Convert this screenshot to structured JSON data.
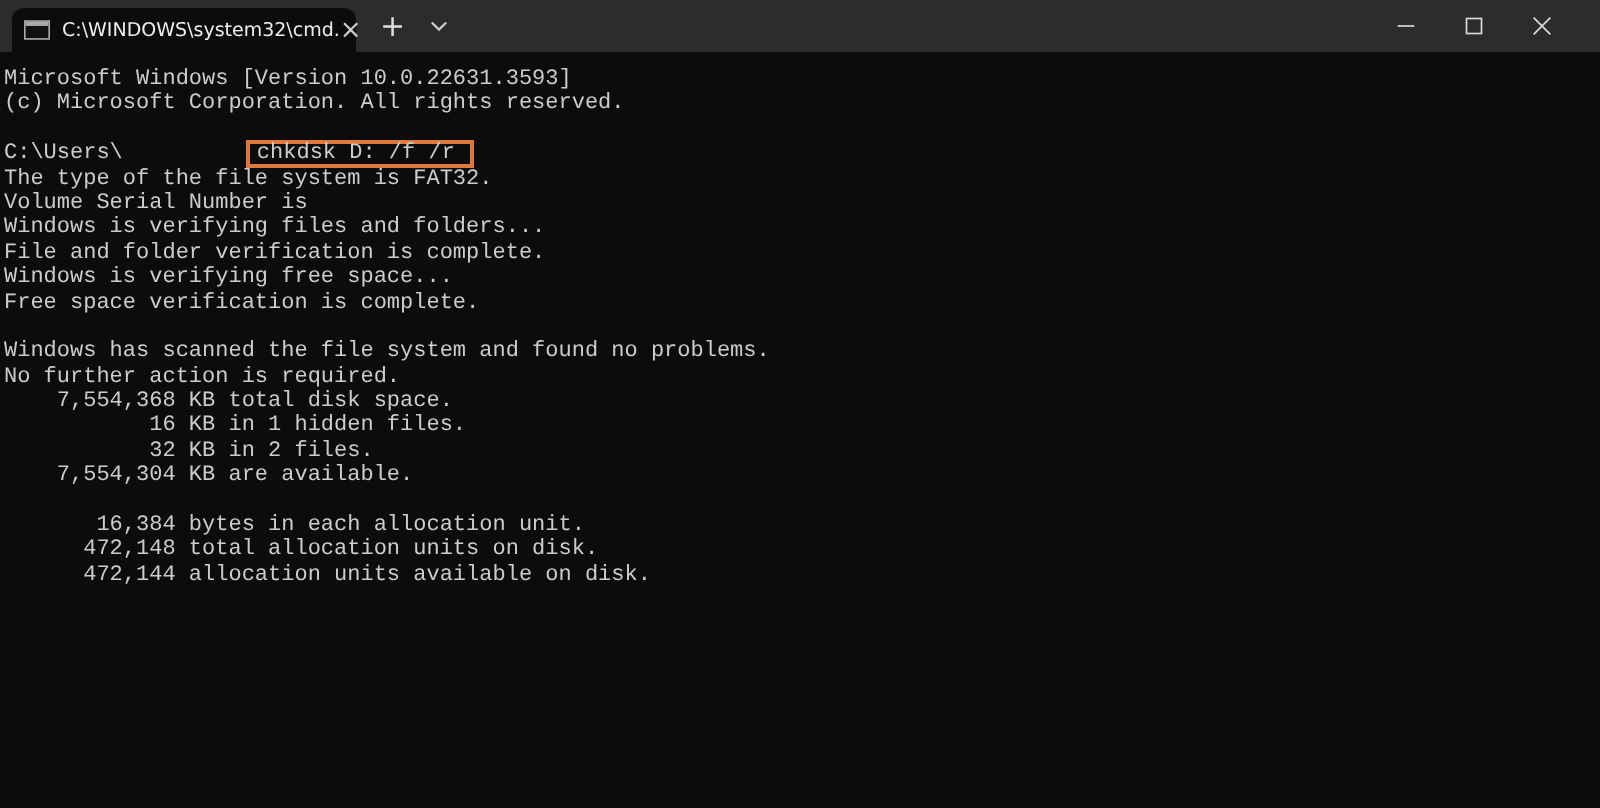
{
  "tab": {
    "title": "C:\\WINDOWS\\system32\\cmd.",
    "close": "×",
    "selected": true
  },
  "new_tab": "+",
  "lines": [
    {
      "kind": "text",
      "text": "Microsoft Windows [Version 10.0.22631.3593]"
    },
    {
      "kind": "text",
      "text": "(c) Microsoft Corporation. All rights reserved."
    },
    {
      "kind": "blank"
    },
    {
      "kind": "prompt",
      "text": "C:\\Users\\",
      "command": "chkdsk D: /f /r"
    },
    {
      "kind": "text",
      "text": "The type of the file system is FAT32."
    },
    {
      "kind": "text",
      "text": "Volume Serial Number is"
    },
    {
      "kind": "text",
      "text": "Windows is verifying files and folders..."
    },
    {
      "kind": "text",
      "text": "File and folder verification is complete."
    },
    {
      "kind": "text",
      "text": "Windows is verifying free space..."
    },
    {
      "kind": "text",
      "text": "Free space verification is complete."
    },
    {
      "kind": "blank"
    },
    {
      "kind": "text",
      "text": "Windows has scanned the file system and found no problems."
    },
    {
      "kind": "text",
      "text": "No further action is required."
    },
    {
      "kind": "text",
      "text": "    7,554,368 KB total disk space."
    },
    {
      "kind": "text",
      "text": "           16 KB in 1 hidden files."
    },
    {
      "kind": "text",
      "text": "           32 KB in 2 files."
    },
    {
      "kind": "text",
      "text": "    7,554,304 KB are available."
    },
    {
      "kind": "blank"
    },
    {
      "kind": "text",
      "text": "       16,384 bytes in each allocation unit."
    },
    {
      "kind": "text",
      "text": "      472,148 total allocation units on disk."
    },
    {
      "kind": "text",
      "text": "      472,144 allocation units available on disk."
    }
  ]
}
